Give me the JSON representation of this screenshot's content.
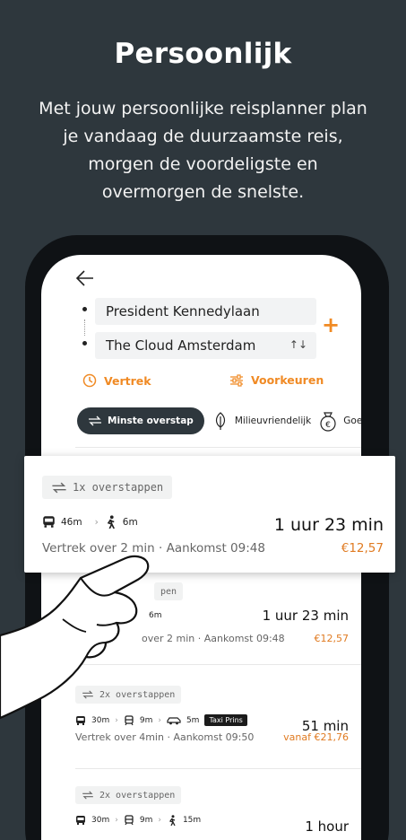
{
  "hero": {
    "title": "Persoonlijk",
    "subtitle": "Met jouw persoonlijke reisplanner plan je vandaag de duurzaamste reis, morgen de voordeligste en overmorgen de snelste."
  },
  "planner": {
    "from": "President Kennedylaan",
    "to": "The Cloud Amsterdam",
    "swap_symbol": "↑↓",
    "add_symbol": "+",
    "departure_label": "Vertrek",
    "preferences_label": "Voorkeuren",
    "filters": [
      "Minste overstap",
      "Milieuvriendelijk",
      "Goedk"
    ]
  },
  "highlight": {
    "transfers": "1x overstappen",
    "leg1": "46m",
    "leg2": "6m",
    "duration": "1 uur 23 min",
    "info": "Vertrek over 2 min · Aankomst 09:48",
    "price": "€12,57"
  },
  "results": [
    {
      "transfers_partial": "pen",
      "leg_partial": "6m",
      "duration": "1 uur 23 min",
      "info_partial": "over 2 min · Aankomst 09:48",
      "price": "€12,57"
    },
    {
      "transfers": "2x overstappen",
      "legs": [
        "30m",
        "9m",
        "5m"
      ],
      "taxi": "Taxi Prins",
      "duration": "51 min",
      "info": "Vertrek over 4min · Aankomst 09:50",
      "price": "vanaf €21,76"
    },
    {
      "transfers": "2x overstappen",
      "legs": [
        "30m",
        "9m",
        "15m"
      ],
      "duration": "1 hour"
    }
  ],
  "colors": {
    "background": "#2e373d",
    "accent": "#f08a24",
    "price": "#e07b22"
  }
}
